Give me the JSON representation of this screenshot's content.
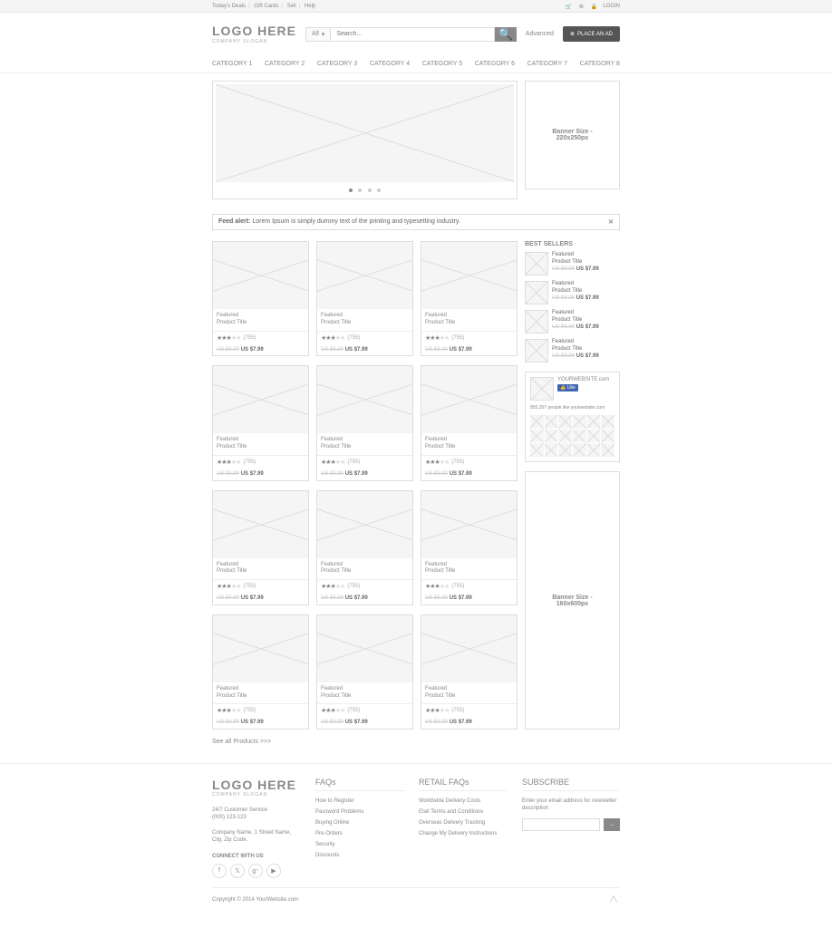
{
  "topbar": {
    "links": [
      "Today's Deals",
      "Gift Cards",
      "Sell",
      "Help"
    ],
    "login": "LOGIN"
  },
  "header": {
    "logo": "LOGO HERE",
    "slogan": "COMPANY SLOGAN",
    "search_cat": "All",
    "search_placeholder": "Search...",
    "advanced": "Advanced",
    "place_ad": "PLACE AN AD"
  },
  "nav": [
    "CATEGORY 1",
    "CATEGORY 2",
    "CATEGORY 3",
    "CATEGORY 4",
    "CATEGORY 5",
    "CATEGORY 6",
    "CATEGORY 7",
    "CATEGORY 8"
  ],
  "banner_side": {
    "line1": "Banner Size -",
    "line2": "220x250px"
  },
  "alert": {
    "label": "Feed alert:",
    "text": "Lorem Ipsum is simply dummy text of the printing and typesetting industry."
  },
  "product": {
    "featured": "Featured",
    "title": "Product Title",
    "rating": "(755)",
    "price_old": "US $8.99",
    "price_new": "US $7.99"
  },
  "bestsellers": {
    "title": "BEST SELLERS",
    "featured": "Featured",
    "product_title": "Product Title",
    "price_old": "US $8.99",
    "price_new": "US $7.99"
  },
  "social": {
    "name": "YOURWEBSITE.com",
    "like": "👍 Like",
    "text": "855,357 people like yourwebsite.com"
  },
  "banner_tall": {
    "line1": "Banner Size -",
    "line2": "160x600px"
  },
  "see_all": "See all Products >>>",
  "footer": {
    "logo": "LOGO HERE",
    "slogan": "COMPANY SLOGAN",
    "customer_service": "24/7 Customer Service",
    "phone": "(000) 123-123",
    "address1": "Company Name, 1 Street Name,",
    "address2": "City, Zip Code.",
    "connect": "CONNECT WITH US",
    "faqs_title": "FAQs",
    "faqs": [
      "How to Register",
      "Password Problems",
      "Buying Online",
      "Pre-Orders",
      "Security",
      "Discounts"
    ],
    "retail_title": "RETAIL FAQs",
    "retail": [
      "Worldwide Delivery Costs",
      "Etail Terms and Conditions",
      "Overseas Delivery Tracking",
      "Change My Delivery Instructions"
    ],
    "sub_title": "SUBSCRIBE",
    "sub_text": "Enter your email address for newsletter description",
    "sub_btn": "→",
    "copyright": "Copyright © 2014 YourWebsite.com"
  }
}
